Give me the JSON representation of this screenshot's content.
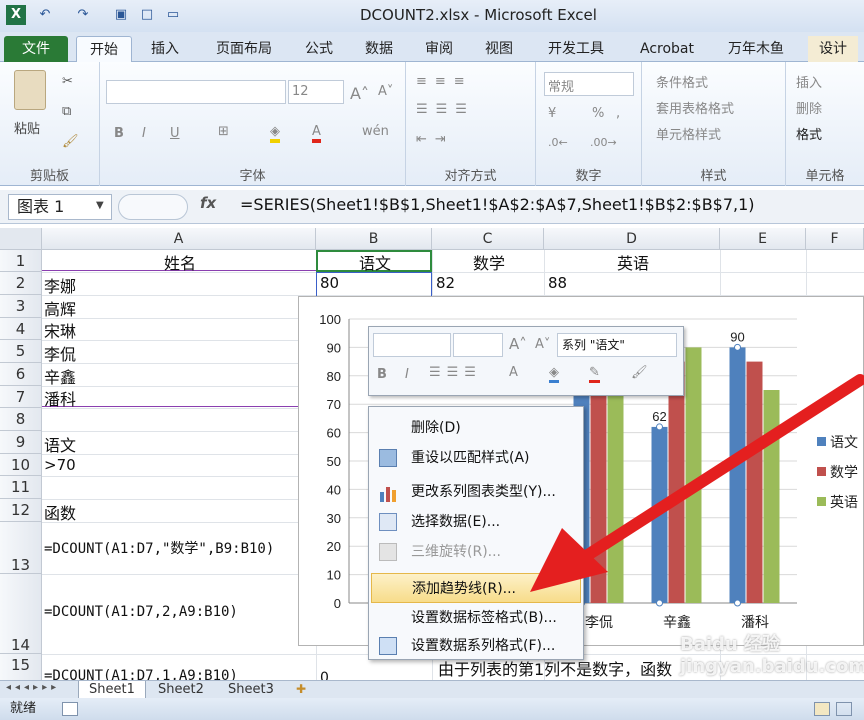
{
  "window": {
    "title": "DCOUNT2.xlsx - Microsoft Excel"
  },
  "tabs": {
    "file": "文件",
    "home": "开始",
    "insert": "插入",
    "layout": "页面布局",
    "formula": "公式",
    "data": "数据",
    "review": "审阅",
    "view": "视图",
    "dev": "开发工具",
    "acrobat": "Acrobat",
    "wanhu": "万年木鱼",
    "design": "设计"
  },
  "ribbon": {
    "clipboard": {
      "label": "剪贴板",
      "paste": "粘贴"
    },
    "font": {
      "label": "字体",
      "size": "12",
      "bold": "B",
      "italic": "I",
      "underline": "U"
    },
    "align": {
      "label": "对齐方式"
    },
    "number": {
      "label": "数字",
      "format": "常规"
    },
    "styles": {
      "label": "样式",
      "cond": "条件格式",
      "table": "套用表格格式",
      "cell": "单元格样式"
    },
    "cells": {
      "label": "单元格",
      "insert": "插入",
      "delete": "删除",
      "format": "格式"
    }
  },
  "formula_bar": {
    "name_box": "图表 1",
    "fx": "fx",
    "formula": "=SERIES(Sheet1!$B$1,Sheet1!$A$2:$A$7,Sheet1!$B$2:$B$7,1)"
  },
  "columns": [
    "A",
    "B",
    "C",
    "D",
    "E",
    "F"
  ],
  "rows": [
    "1",
    "2",
    "3",
    "4",
    "5",
    "6",
    "7",
    "8",
    "9",
    "10",
    "11",
    "12",
    "13",
    "14",
    "15"
  ],
  "cells": {
    "a1": "姓名",
    "b1": "语文",
    "c1": "数学",
    "d1": "英语",
    "a2": "李娜",
    "b2": "80",
    "c2": "82",
    "d2": "88",
    "a3": "高辉",
    "a4": "宋琳",
    "a5": "李侃",
    "a6": "辛鑫",
    "a7": "潘科",
    "a9": "语文",
    "a10": ">70",
    "a12": "函数",
    "a13": "=DCOUNT(A1:D7,\"数学\",B9:B10)",
    "a14": "=DCOUNT(A1:D7,2,A9:B10)",
    "a15": "=DCOUNT(A1:D7,1,A9:B10)",
    "b15": "0",
    "c15": "由于列表的第1列不是数字，函数"
  },
  "chart_data": {
    "type": "bar",
    "categories": [
      "李侃",
      "辛鑫",
      "潘科"
    ],
    "series": [
      {
        "name": "语文",
        "color": "#4f81bd",
        "values": [
          85,
          62,
          90
        ]
      },
      {
        "name": "数学",
        "color": "#c0504d",
        "values": [
          86,
          85,
          85
        ]
      },
      {
        "name": "英语",
        "color": "#9bbb59",
        "values": [
          90,
          90,
          75
        ]
      }
    ],
    "ylim": [
      0,
      100
    ],
    "yticks": [
      "0",
      "10",
      "20",
      "30",
      "40",
      "50",
      "60",
      "70",
      "80",
      "90",
      "100"
    ],
    "data_labels": [
      "62",
      "90"
    ],
    "legend": "right"
  },
  "mini_toolbar": {
    "series_select": "系列 \"语文\""
  },
  "context_menu": {
    "items": [
      {
        "label": "删除(D)",
        "icon": "none",
        "disabled": false
      },
      {
        "label": "重设以匹配样式(A)",
        "icon": "reset-icon",
        "disabled": false
      },
      {
        "label": "更改系列图表类型(Y)...",
        "icon": "chart-type-icon",
        "disabled": false
      },
      {
        "label": "选择数据(E)...",
        "icon": "select-data-icon",
        "disabled": false
      },
      {
        "label": "三维旋转(R)...",
        "icon": "rotate-icon",
        "disabled": true
      },
      {
        "label": "添加趋势线(R)...",
        "icon": "none",
        "disabled": false
      },
      {
        "label": "设置数据标签格式(B)...",
        "icon": "none",
        "disabled": false
      },
      {
        "label": "设置数据系列格式(F)...",
        "icon": "format-series-icon",
        "disabled": false
      }
    ]
  },
  "sheet_tabs": [
    "Sheet1",
    "Sheet2",
    "Sheet3"
  ],
  "status": {
    "ready": "就绪"
  },
  "watermark": "Baidu 经验 jingyan.baidu.com"
}
